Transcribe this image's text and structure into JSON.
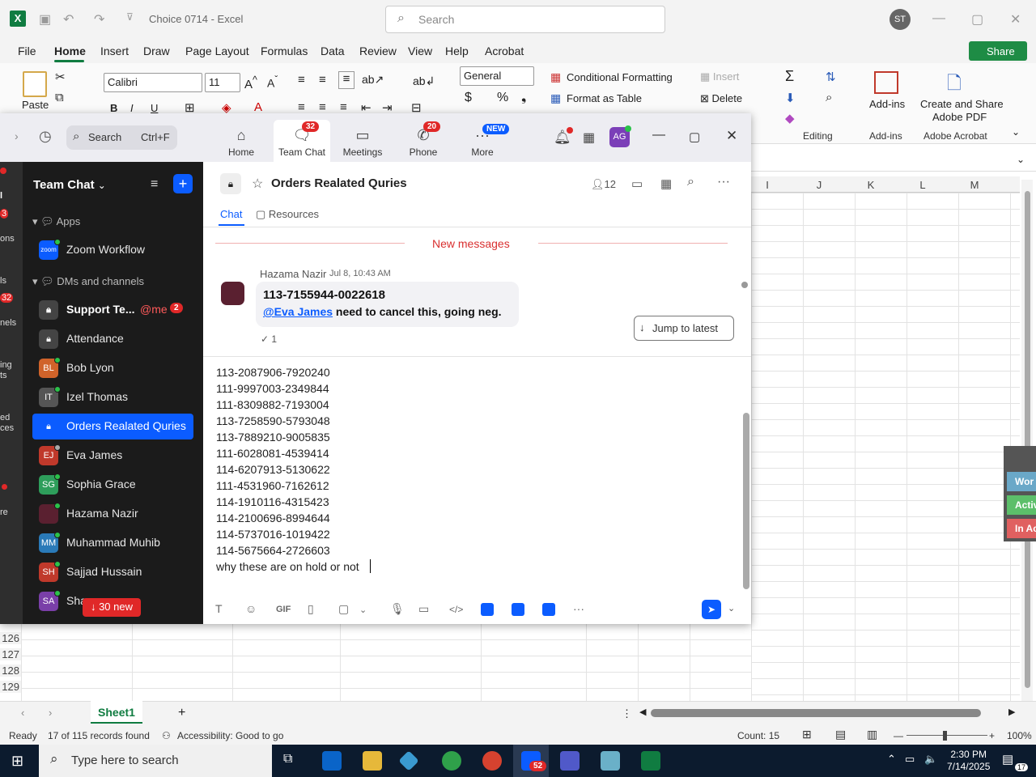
{
  "excel": {
    "doc_title": "Choice 0714  -  Excel",
    "search_placeholder": "Search",
    "avatar": "ST",
    "menu": [
      "File",
      "Home",
      "Insert",
      "Draw",
      "Page Layout",
      "Formulas",
      "Data",
      "Review",
      "View",
      "Help",
      "Acrobat"
    ],
    "share": "Share",
    "ribbon": {
      "paste": "Paste",
      "font": "Calibri",
      "size": "11",
      "number_format": "General",
      "cond_format": "Conditional Formatting",
      "format_table": "Format as Table",
      "insert": "Insert",
      "delete": "Delete",
      "editing": "Editing",
      "addins": "Add-ins",
      "addins_group": "Add-ins",
      "create_share": "Create and Share",
      "adobe_pdf": "Adobe PDF",
      "adobe_group": "Adobe Acrobat",
      "dollar": "$",
      "percent": "%"
    },
    "columns": [
      "I",
      "J",
      "K",
      "L",
      "M"
    ],
    "rows": [
      "126",
      "127",
      "128",
      "129"
    ],
    "sheet_tab": "Sheet1",
    "status": {
      "ready": "Ready",
      "records": "17 of 115 records found",
      "accessibility": "Accessibility: Good to go",
      "count": "Count: 15",
      "zoom": "100%"
    },
    "side_tags": [
      {
        "label": "Wor",
        "color": "#6aa8c8"
      },
      {
        "label": "Activ",
        "color": "#5cbf6a"
      },
      {
        "label": "In Ac",
        "color": "#e06060"
      }
    ]
  },
  "taskbar": {
    "search": "Type here to search",
    "time": "2:30 PM",
    "date": "7/14/2025",
    "notif": "17",
    "zoom_badge": "52"
  },
  "zoom": {
    "nav": [
      {
        "label": "Home",
        "badge": ""
      },
      {
        "label": "Team Chat",
        "badge": "32"
      },
      {
        "label": "Meetings",
        "badge": ""
      },
      {
        "label": "Phone",
        "badge": "20"
      },
      {
        "label": "More",
        "badge": "NEW"
      }
    ],
    "search": "Search",
    "search_shortcut": "Ctrl+F",
    "avatar": "AG",
    "rail": [
      {
        "text": "3",
        "badge": true
      },
      {
        "text": "ons"
      },
      {
        "text": "ls"
      },
      {
        "text": "32",
        "badge": true
      },
      {
        "text": "nels"
      },
      {
        "text": "ing"
      },
      {
        "text": "ts"
      },
      {
        "text": "ed"
      },
      {
        "text": "ces"
      },
      {
        "text": "re"
      }
    ],
    "sidebar": {
      "title": "Team Chat",
      "apps_label": "Apps",
      "dms_label": "DMs and channels",
      "items": [
        {
          "label": "Zoom Workflow",
          "av": "zoom",
          "color": "#0b5cff"
        },
        {
          "label": "Support Te...",
          "mention": "@me",
          "count": "2",
          "av": "🔒",
          "color": "#444"
        },
        {
          "label": "Attendance",
          "av": "🔒",
          "color": "#444"
        },
        {
          "label": "Bob Lyon",
          "av": "BL",
          "color": "#d0632a"
        },
        {
          "label": "Izel Thomas",
          "av": "IT",
          "color": "#555"
        },
        {
          "label": "Orders Realated Quries",
          "av": "🔒",
          "color": "#0b5cff"
        },
        {
          "label": "Eva James",
          "av": "EJ",
          "color": "#c0392b"
        },
        {
          "label": "Sophia Grace",
          "av": "SG",
          "color": "#2e9e5b"
        },
        {
          "label": "Hazama Nazir",
          "av": "",
          "color": "#5a2030"
        },
        {
          "label": "Muhammad Muhib",
          "av": "MM",
          "color": "#2a7ab8"
        },
        {
          "label": "Sajjad Hussain",
          "av": "SH",
          "color": "#c0392b"
        },
        {
          "label": "Sha...",
          "av": "SA",
          "color": "#7a3fa8"
        }
      ],
      "new_button": "↓ 30 new"
    },
    "channel": {
      "name": "Orders Realated Quries",
      "members": "12",
      "tabs": [
        "Chat",
        "Resources"
      ]
    },
    "new_messages": "New messages",
    "message": {
      "sender": "Hazama Nazir",
      "time": "Jul 8, 10:43 AM",
      "line1": "113-7155944-0022618",
      "mention": "@Eva James",
      "line2": " need to cancel this, going neg.",
      "reactions": "1"
    },
    "jump": "Jump to latest",
    "composer_lines": [
      "113-2087906-7920240",
      "111-9997003-2349844",
      "111-8309882-7193004",
      "113-7258590-5793048",
      "113-7889210-9005835",
      "111-6028081-4539414",
      "114-6207913-5130622",
      "111-4531960-7162612",
      "114-1910116-4315423",
      "114-2100696-8994644",
      "114-5737016-1019422",
      "114-5675664-2726603",
      "why these are on hold or not"
    ]
  }
}
